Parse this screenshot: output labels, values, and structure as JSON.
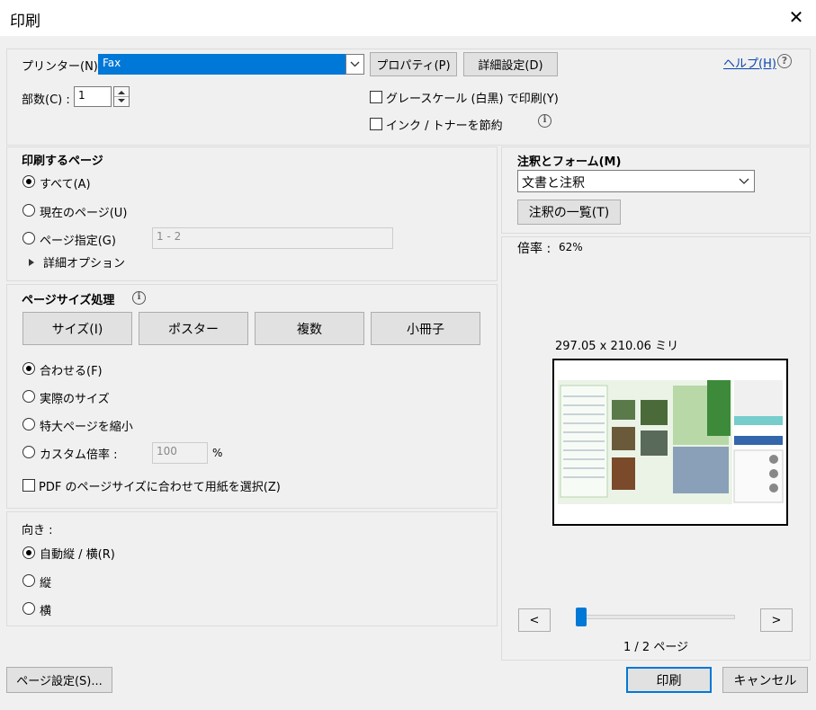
{
  "dialog": {
    "title": "印刷",
    "close": "✕"
  },
  "printer": {
    "label": "プリンター(N) :",
    "value": "Fax",
    "properties_button": "プロパティ(P)",
    "advanced_button": "詳細設定(D)",
    "help_link": "ヘルプ(H)",
    "copies_label": "部数(C) :",
    "copies_value": "1",
    "grayscale_label": "グレースケール (白黒) で印刷(Y)",
    "save_ink_label": "インク / トナーを節約"
  },
  "pages": {
    "heading": "印刷するページ",
    "all": "すべて(A)",
    "current": "現在のページ(U)",
    "range": "ページ指定(G)",
    "range_value": "1 - 2",
    "more_options": "詳細オプション"
  },
  "sizing": {
    "heading": "ページサイズ処理",
    "size_button": "サイズ(I)",
    "poster_button": "ポスター",
    "multiple_button": "複数",
    "booklet_button": "小冊子",
    "fit": "合わせる(F)",
    "actual": "実際のサイズ",
    "shrink": "特大ページを縮小",
    "custom": "カスタム倍率 :",
    "custom_value": "100",
    "percent": "%",
    "pdf_paper": "PDF のページサイズに合わせて用紙を選択(Z)"
  },
  "orientation": {
    "heading": "向き :",
    "auto": "自動縦 / 横(R)",
    "portrait": "縦",
    "landscape": "横"
  },
  "annotations": {
    "heading": "注釈とフォーム(M)",
    "value": "文書と注釈",
    "summary_button": "注釈の一覧(T)"
  },
  "preview": {
    "scale_label": "倍率 :",
    "scale_value": "62%",
    "dimensions": "297.05 x 210.06 ミリ",
    "prev": "<",
    "next": ">",
    "page_indicator": "1 / 2 ページ",
    "slider_position": 0
  },
  "footer": {
    "page_setup_button": "ページ設定(S)...",
    "print_button": "印刷",
    "cancel_button": "キャンセル"
  },
  "colors": {
    "selection": "#0078d7",
    "link": "#0645ad",
    "preview_green": "#cfe8c9"
  }
}
